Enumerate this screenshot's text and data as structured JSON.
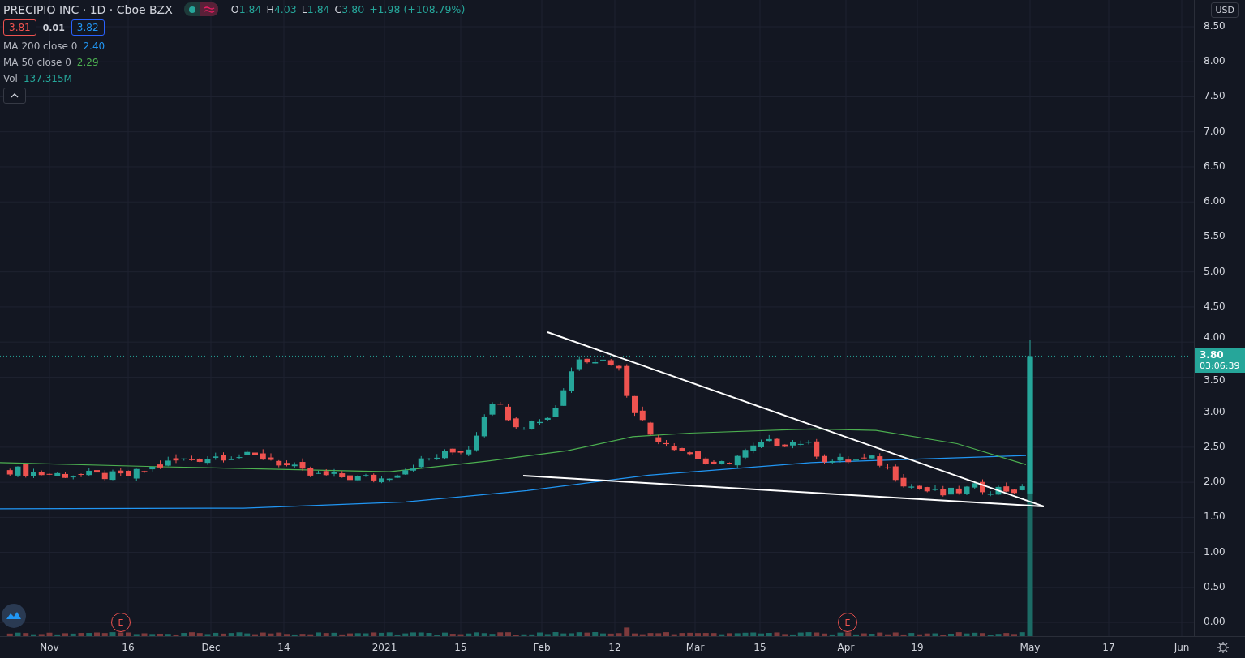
{
  "legend": {
    "title": "PRECIPIO INC · 1D · Cboe BZX",
    "ohlc": [
      {
        "label": "O",
        "value": "1.84"
      },
      {
        "label": "H",
        "value": "4.03"
      },
      {
        "label": "L",
        "value": "1.84"
      },
      {
        "label": "C",
        "value": "3.80"
      }
    ],
    "change": "+1.98 (+108.79%)",
    "quote": {
      "bid": "3.81",
      "spread": "0.01",
      "ask": "3.82"
    },
    "indicators": [
      {
        "name": "MA 200 close 0",
        "value": "2.40",
        "color": "#2196f3"
      },
      {
        "name": "MA 50 close 0",
        "value": "2.29",
        "color": "#4caf50"
      },
      {
        "name": "Vol",
        "value": "137.315M",
        "color": "#26a69a"
      }
    ]
  },
  "events": [
    {
      "label": "E"
    },
    {
      "label": "E"
    }
  ],
  "price_axis": {
    "currency": "USD",
    "ticks": [
      "8.50",
      "8.00",
      "7.50",
      "7.00",
      "6.50",
      "6.00",
      "5.50",
      "5.00",
      "4.50",
      "4.00",
      "3.50",
      "3.00",
      "2.50",
      "2.00",
      "1.50",
      "1.00",
      "0.50",
      "0.00"
    ],
    "last_price": "3.80",
    "countdown": "03:06:39"
  },
  "time_axis": {
    "ticks": [
      "Nov",
      "16",
      "Dec",
      "14",
      "2021",
      "15",
      "Feb",
      "12",
      "Mar",
      "15",
      "Apr",
      "19",
      "May",
      "17",
      "Jun"
    ]
  }
}
